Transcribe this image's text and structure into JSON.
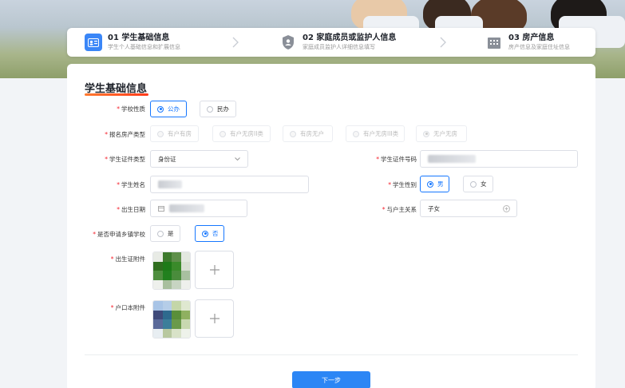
{
  "steps": [
    {
      "title": "01 学生基础信息",
      "subtitle": "学生个人基础信息和扩展信息",
      "icon": "id-card-icon"
    },
    {
      "title": "02 家庭成员或监护人信息",
      "subtitle": "家庭成员监护人详细信息填写",
      "icon": "shield-icon"
    },
    {
      "title": "03 房产信息",
      "subtitle": "房产信息及家庭住址信息",
      "icon": "building-icon"
    }
  ],
  "section_title": "学生基础信息",
  "fields": {
    "school_type": {
      "label": "学校性质",
      "options": [
        "公办",
        "民办"
      ],
      "selected": "公办"
    },
    "housing_type": {
      "label": "报名房产类型",
      "options": [
        "有户有房",
        "有户无房II类",
        "有房无户",
        "有户无房III类",
        "无户无房"
      ],
      "selected": "无户无房"
    },
    "id_type": {
      "label": "学生证件类型",
      "value": "身份证"
    },
    "id_number": {
      "label": "学生证件号码"
    },
    "name": {
      "label": "学生姓名"
    },
    "gender": {
      "label": "学生性别",
      "options": [
        "男",
        "女"
      ],
      "selected": "男"
    },
    "birth_date": {
      "label": "出生日期"
    },
    "relation": {
      "label": "与户主关系",
      "value": "子女"
    },
    "rural": {
      "label": "是否申请乡镇学校",
      "options": [
        "是",
        "否"
      ],
      "selected": "否"
    },
    "birth_cert": {
      "label": "出生证附件"
    },
    "hukou": {
      "label": "户口本附件"
    }
  },
  "next_button": "下一步",
  "colors": {
    "primary": "#1677ff",
    "required": "#f5222d",
    "title_accent": "#ff5a1f"
  }
}
